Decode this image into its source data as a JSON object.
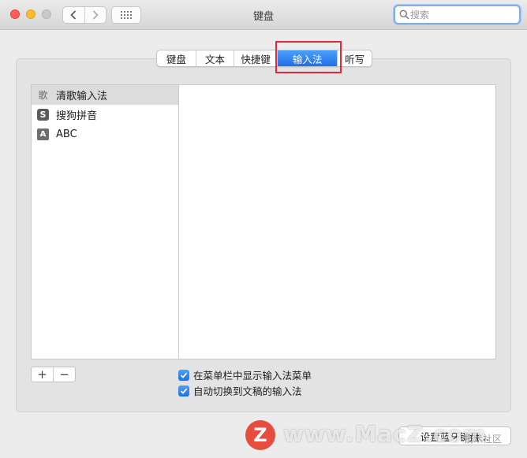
{
  "window": {
    "title": "键盘"
  },
  "search": {
    "placeholder": "搜索"
  },
  "tabs": [
    {
      "label": "键盘",
      "active": false
    },
    {
      "label": "文本",
      "active": false
    },
    {
      "label": "快捷键",
      "active": false
    },
    {
      "label": "输入法",
      "active": true
    },
    {
      "label": "听写",
      "active": false
    }
  ],
  "input_sources": [
    {
      "label": "清歌输入法",
      "icon": "歌",
      "selected": true
    },
    {
      "label": "搜狗拼音",
      "icon": "S",
      "selected": false
    },
    {
      "label": "ABC",
      "icon": "A",
      "selected": false
    }
  ],
  "list_controls": {
    "add": "+",
    "remove": "−"
  },
  "options": {
    "show_in_menu_bar": {
      "label": "在菜单栏中显示输入法菜单",
      "checked": true
    },
    "auto_switch": {
      "label": "自动切换到文稿的输入法",
      "checked": true
    }
  },
  "footer": {
    "setup_button": "设置蓝牙键盘…"
  },
  "watermark": {
    "logo": "Z",
    "text": "www.MacZ.com",
    "sub": "技术社区"
  },
  "colors": {
    "accent": "#1f6fe8",
    "highlight": "#e0293a",
    "close": "#fe5f57",
    "minimize": "#febc2e"
  }
}
